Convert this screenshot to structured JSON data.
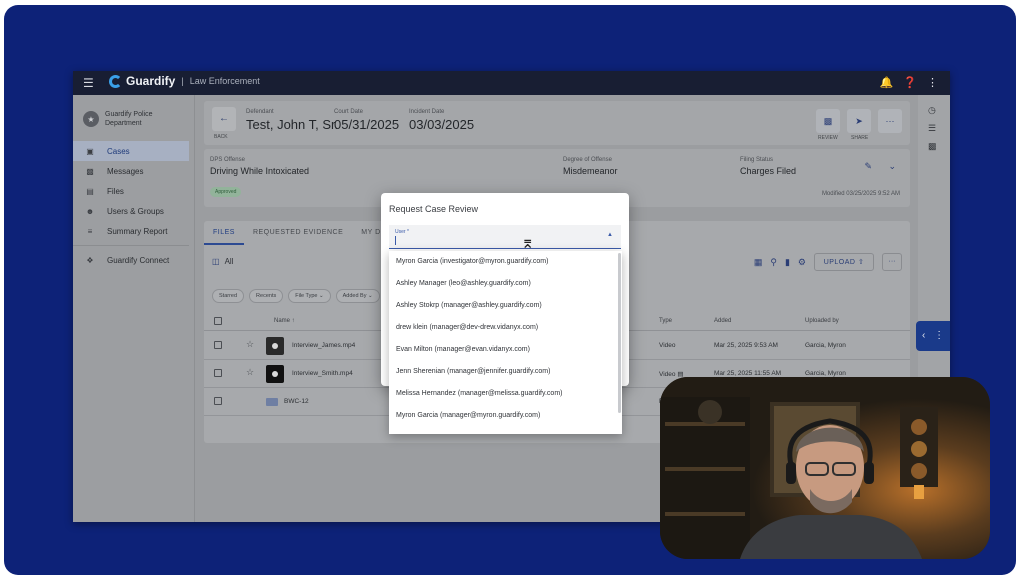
{
  "topbar": {
    "app_name": "Guardify",
    "separator": "|",
    "module": "Law Enforcement",
    "menu_icon": "hamburger-icon",
    "bell_icon": "bell-icon",
    "help_icon": "help-icon",
    "more_icon": "kebab-icon"
  },
  "sidebar": {
    "department": "Guardify Police Department",
    "items": [
      {
        "label": "Cases",
        "icon": "briefcase-icon"
      },
      {
        "label": "Messages",
        "icon": "chat-icon"
      },
      {
        "label": "Files",
        "icon": "file-icon"
      },
      {
        "label": "Users & Groups",
        "icon": "users-icon"
      },
      {
        "label": "Summary Report",
        "icon": "report-icon"
      },
      {
        "label": "Guardify Connect",
        "icon": "connect-icon"
      }
    ]
  },
  "case_header": {
    "back_label": "BACK",
    "defendant_label": "Defendant",
    "defendant": "Test, John T, Sr.",
    "court_date_label": "Court Date",
    "court_date": "05/31/2025",
    "incident_date_label": "Incident Date",
    "incident_date": "03/03/2025",
    "review_label": "REVIEW",
    "share_label": "SHARE"
  },
  "case_info": {
    "offense_label": "DPS Offense",
    "offense": "Driving While Intoxicated",
    "degree_label": "Degree of Offense",
    "degree": "Misdemeanor",
    "filing_label": "Filing Status",
    "filing": "Charges Filed",
    "status_badge": "Approved",
    "modified": "Modified 03/25/2025 9:52 AM"
  },
  "files": {
    "tabs": [
      "FILES",
      "REQUESTED EVIDENCE",
      "MY DOWN"
    ],
    "all_label": "All",
    "upload_label": "UPLOAD",
    "more_label": "···",
    "chips": [
      "Starred",
      "Recents",
      "File Type ⌄",
      "Added By ⌄"
    ],
    "columns": {
      "name": "Name ↑",
      "type": "Type",
      "added": "Added",
      "uploaded_by": "Uploaded by"
    },
    "rows": [
      {
        "name": "Interview_James.mp4",
        "type": "Video",
        "added": "Mar 25, 2025 9:53 AM",
        "uploaded_by": "Garcia, Myron"
      },
      {
        "name": "Interview_Smith.mp4",
        "type": "Video ▤",
        "added": "Mar 25, 2025 11:55 AM",
        "uploaded_by": "Garcia, Myron"
      },
      {
        "name": "BWC-12",
        "type": "Fo",
        "added": "",
        "uploaded_by": ""
      }
    ]
  },
  "modal": {
    "title": "Request Case Review",
    "field_label": "User *",
    "options": [
      "Myron Garcia (investigator@myron.guardify.com)",
      "Ashley Manager (leo@ashley.guardify.com)",
      "Ashley Stokrp (manager@ashley.guardify.com)",
      "drew klein (manager@dev-drew.vidanyx.com)",
      "Evan Milton (manager@evan.vidanyx.com)",
      "Jenn Sherenian (manager@jennifer.guardify.com)",
      "Melissa Hernandez (manager@melissa.guardify.com)",
      "Myron Garcia (manager@myron.guardify.com)"
    ]
  },
  "colors": {
    "frame": "#0d2278",
    "topbar": "#181e33",
    "accent": "#3b5ba9",
    "logo": "#3aa0e8"
  }
}
